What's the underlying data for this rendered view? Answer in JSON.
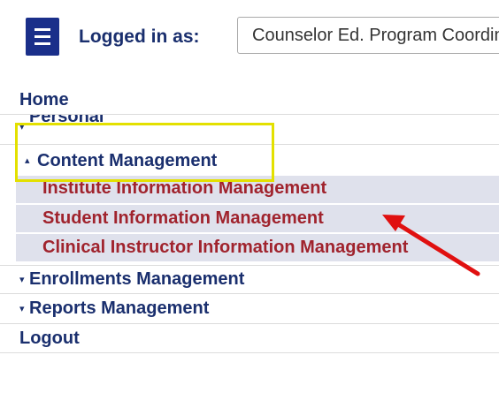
{
  "header": {
    "logged_in_label": "Logged in as:",
    "program_value": "Counselor Ed. Program Coordinator"
  },
  "nav": {
    "home": "Home",
    "personal": "Personal",
    "content_management": "Content Management",
    "sub_items": [
      "Institute Information Management",
      "Student Information Management",
      "Clinical Instructor Information Management"
    ],
    "enrollments": "Enrollments Management",
    "reports": "Reports Management",
    "logout": "Logout"
  },
  "colors": {
    "nav_text": "#1a2f6e",
    "sub_text": "#a0232d",
    "highlight": "#e3e000",
    "arrow": "#e01010"
  }
}
